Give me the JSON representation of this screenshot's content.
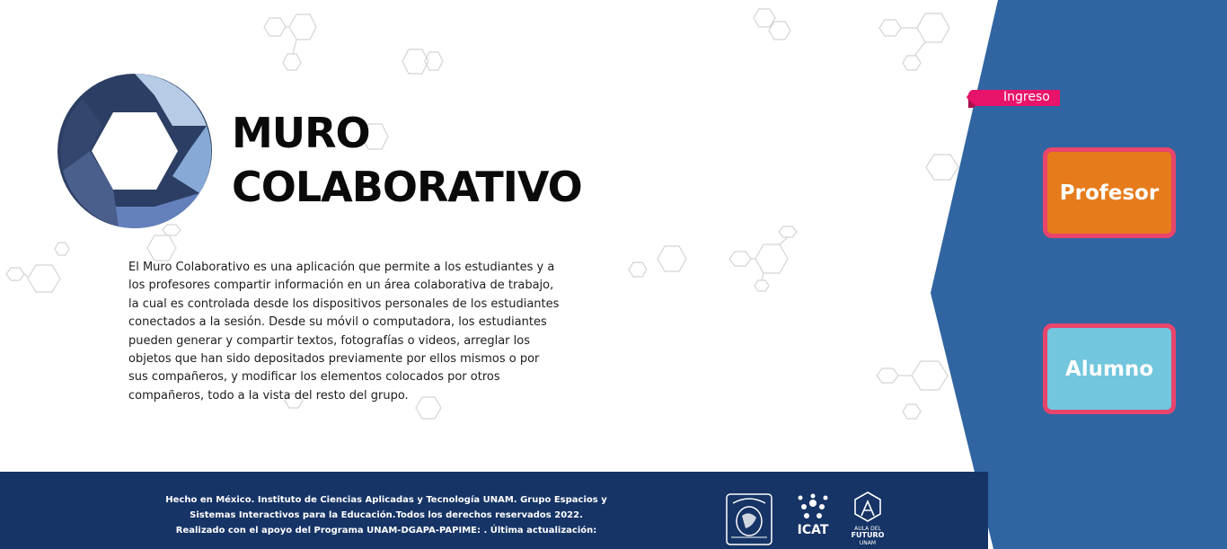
{
  "app": {
    "title_line1": "MURO",
    "title_line2": "COLABORATIVO",
    "description": "El Muro Colaborativo es una aplicación que permite a los estudiantes y a los profesores compartir información en un área colaborativa de trabajo, la cual es controlada desde los dispositivos personales de los estudiantes conectados a la sesión. Desde su móvil o computadora, los estudiantes pueden generar y compartir textos, fotografías o videos, arreglar los objetos que han sido depositados previamente por ellos mismos o por sus compañeros, y modificar los elementos colocados por otros compañeros, todo a la vista del resto del grupo."
  },
  "login": {
    "tag_label": "Ingreso",
    "profesor_label": "Profesor",
    "alumno_label": "Alumno"
  },
  "footer": {
    "line1": "Hecho en México. Instituto de Ciencias Aplicadas y Tecnología UNAM. Grupo Espacios y",
    "line2": "Sistemas Interactivos para la Educación.Todos los derechos reservados 2022.",
    "line3": "Realizado con el apoyo del Programa UNAM-DGAPA-PAPIME: . Última actualización:",
    "icat_text": "ICAT",
    "aula_text_1": "AULA DEL",
    "aula_text_2": "FUTURO",
    "aula_text_3": "UNAM"
  },
  "colors": {
    "panel_blue": "#3065a1",
    "footer_navy": "#163466",
    "profesor_orange": "#e67b1c",
    "alumno_cyan": "#72c6dd",
    "button_border": "#e8456c",
    "ingreso_pink": "#e8136a"
  },
  "icons": [
    "hexagon-logo-icon",
    "unam-seal-icon",
    "icat-logo-icon",
    "aula-futuro-logo-icon",
    "molecule-decoration"
  ]
}
